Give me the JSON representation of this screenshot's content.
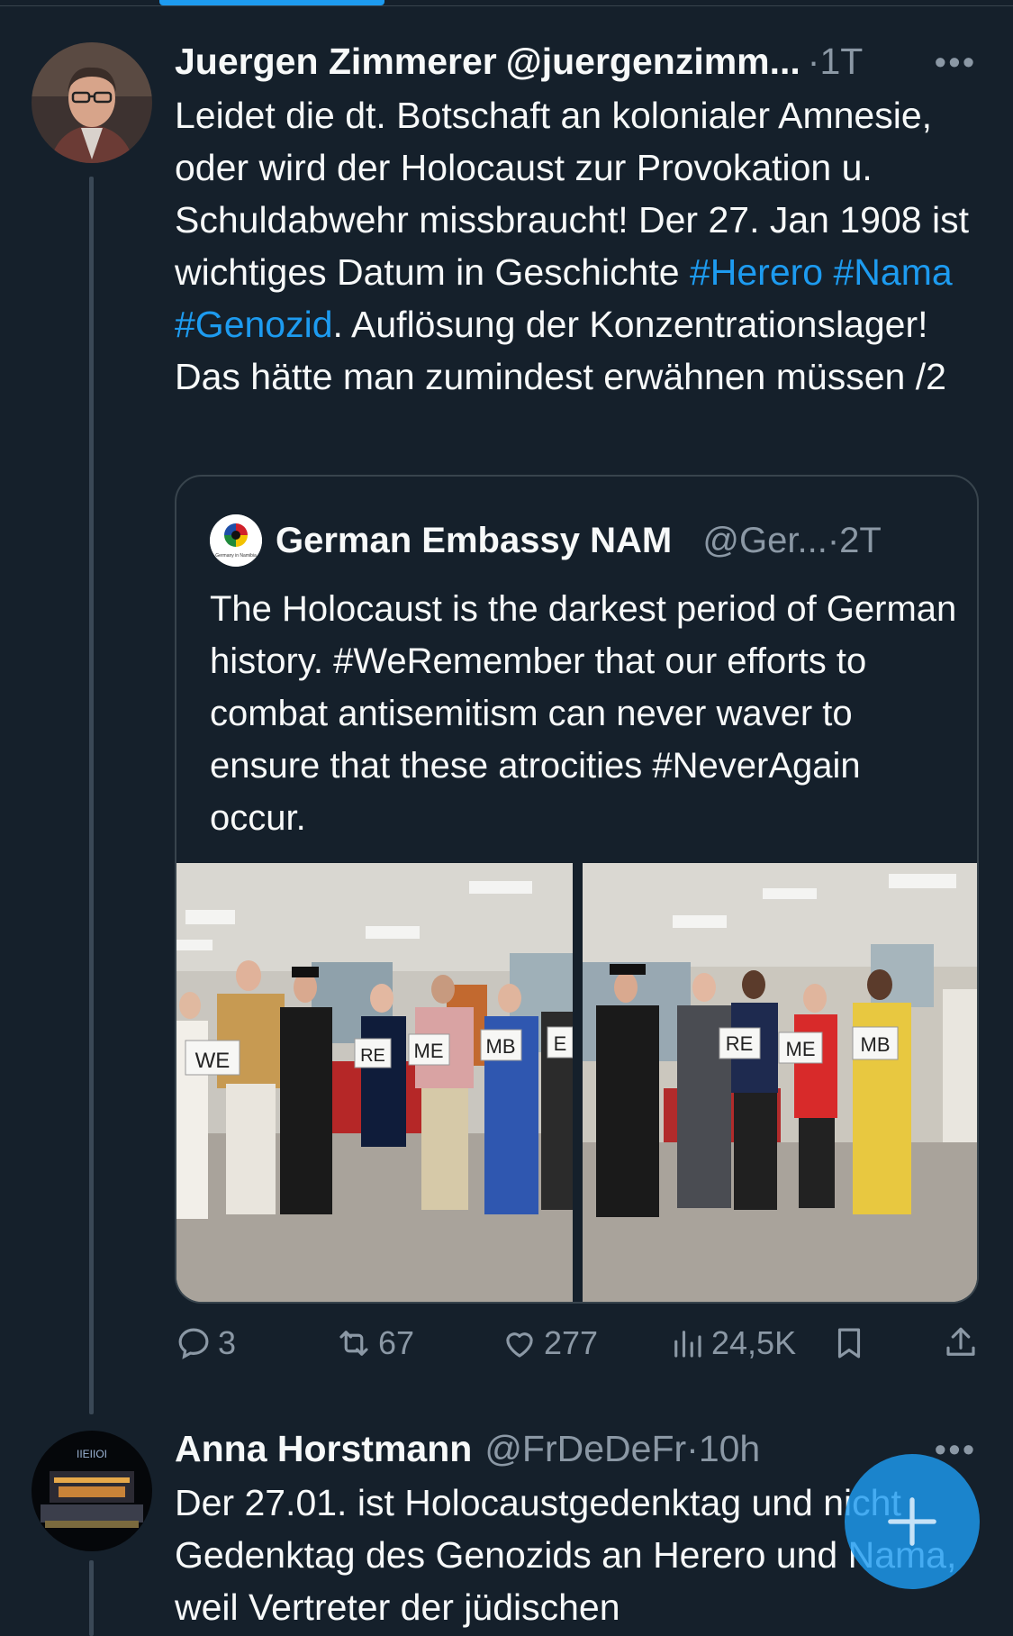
{
  "post1": {
    "name": "Juergen Zimmerer",
    "handle": "@juergenzimm...",
    "dot": "·",
    "time": "1T",
    "more": "•••",
    "text_plain_1": "Leidet die dt. Botschaft an kolonialer Amnesie, oder wird der Holocaust zur Provokation u. Schuldabwehr missbraucht! Der 27. Jan 1908 ist wichtiges Datum in Geschichte ",
    "hashtags": [
      "#Herero",
      "#Nama",
      "#Genozid"
    ],
    "text_plain_2": ". Auflösung der Konzentrationslager! Das hätte man zumindest erwähnen müssen /2",
    "quote": {
      "avatar_label": "Germany in Namibia",
      "name": "German Embassy NAM",
      "handle": "@Ger...",
      "dot": "·",
      "time": "2T",
      "text": "The Holocaust is the darkest period of German history. #WeRemember that our efforts to combat antisemitism can never waver to ensure that these atrocities #NeverAgain occur.",
      "photo1_signs": [
        "WE",
        "RE",
        "ME",
        "MB",
        "E"
      ],
      "photo2_signs": [
        "RE",
        "ME",
        "MB"
      ]
    },
    "actions": {
      "replies": "3",
      "reposts": "67",
      "likes": "277",
      "views": "24,5K"
    }
  },
  "post2": {
    "name": "Anna Horstmann",
    "handle": "@FrDeDeFr",
    "dot": "·",
    "time": "10h",
    "more": "•••",
    "text": "Der 27.01. ist Holocaustgedenktag und nicht Gedenktag des Genozids an Herero und Nama, weil Vertreter der jüdischen"
  },
  "colors": {
    "background": "#15202b",
    "accent": "#1d9bf0",
    "secondary_text": "#8b98a5",
    "border": "#38444d"
  }
}
